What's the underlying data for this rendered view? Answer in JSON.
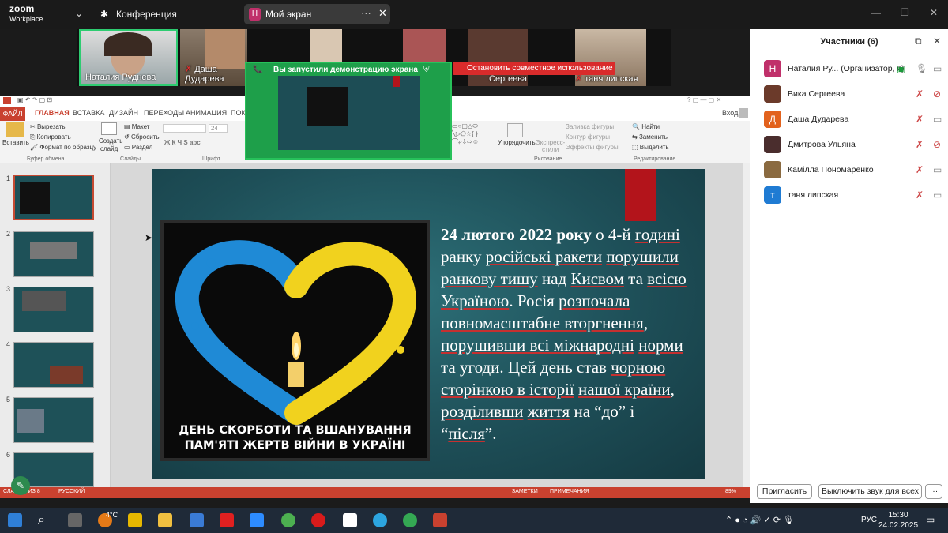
{
  "zoom": {
    "logo_top": "zoom",
    "logo_bottom": "Workplace",
    "meeting_label": "Конференция",
    "screen_badge": "Н",
    "screen_label": "Мой экран",
    "more": "⋯",
    "close": "✕"
  },
  "videos": [
    {
      "name": "Наталия Руднева"
    },
    {
      "name": "Даша Дударева"
    },
    {
      "name": "Вика Сергеева"
    },
    {
      "name": "таня липская"
    }
  ],
  "share": {
    "banner": "Вы запустили демонстрацию экрана",
    "stop": "Остановить совместное использование"
  },
  "ppt": {
    "tabs": [
      "ФАЙЛ",
      "ГЛАВНАЯ",
      "ВСТАВКА",
      "ДИЗАЙН",
      "ПЕРЕХОДЫ",
      "АНИМАЦИЯ",
      "ПОКА"
    ],
    "signin": "Вход",
    "ribbon": {
      "paste": "Вставить",
      "cut": "Вырезать",
      "copy": "Копировать",
      "format": "Формат по образцу",
      "clipboard": "Буфер обмена",
      "create": "Создать",
      "slide": "слайд",
      "layout": "Макет",
      "reset": "Сбросить",
      "section": "Раздел",
      "slides": "Слайды",
      "font": "Шрифт",
      "fontsize": "24",
      "fill": "Заливка фигуры",
      "outline": "Контур фигуры",
      "effects": "Эффекты фигуры",
      "arrange": "Упорядочить",
      "express": "Экспресс-",
      "styles": "стили",
      "drawing": "Рисование",
      "find": "Найти",
      "replace": "Заменить",
      "select": "Выделить",
      "editing": "Редактирование"
    },
    "thumbs": [
      "1",
      "2",
      "3",
      "4",
      "5",
      "6"
    ],
    "slide": {
      "caption_line1": "ДЕНЬ СКОРБОТИ ТА ВШАНУВАННЯ",
      "caption_line2": "ПАМ'ЯТІ ЖЕРТВ ВІЙНИ В УКРАЇНІ"
    },
    "status": {
      "slide": "СЛАЙД 1 ИЗ 8",
      "lang": "РУССКИЙ",
      "notes": "ЗАМЕТКИ",
      "comments": "ПРИМЕЧАНИЯ",
      "zoom": "89%"
    }
  },
  "participants": {
    "title": "Участники (6)",
    "list": [
      {
        "avatar": "Н",
        "name": "Наталия Ру...  (Организатор, я)",
        "color": "#c0306a"
      },
      {
        "avatar": "",
        "name": "Вика Сергеева",
        "color": "#6b3a2a"
      },
      {
        "avatar": "Д",
        "name": "Даша Дударева",
        "color": "#e2621d"
      },
      {
        "avatar": "",
        "name": "Дмитрова Ульяна",
        "color": "#4a2d2d"
      },
      {
        "avatar": "",
        "name": "Камілла Пономаренко",
        "color": "#8a6a40"
      },
      {
        "avatar": "т",
        "name": "таня липская",
        "color": "#1f7bd3"
      }
    ],
    "invite": "Пригласить",
    "mute_all": "Выключить звук для всех",
    "more": "···"
  },
  "taskbar": {
    "weather": "4°C",
    "lang": "РУС",
    "time": "15:30",
    "date": "24.02.2025"
  }
}
